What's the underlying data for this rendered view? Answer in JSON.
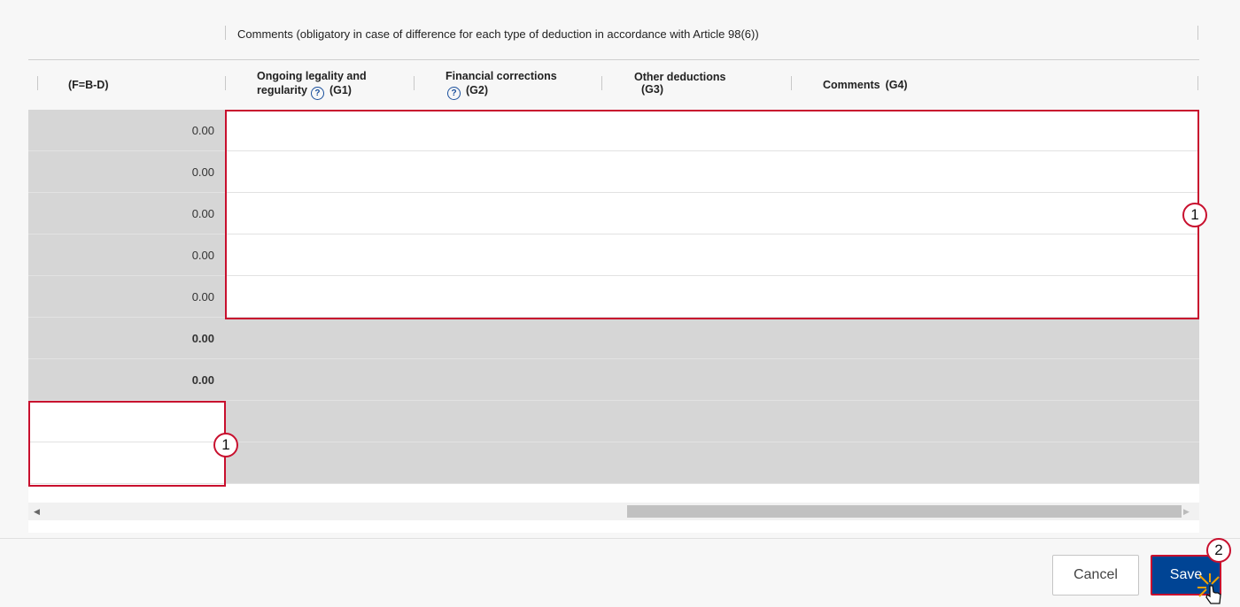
{
  "table": {
    "group_title": "Comments (obligatory in case of difference for each type of deduction in accordance with Article 98(6))",
    "columns": {
      "f": "(F=B-D)",
      "g1_line1": "Ongoing legality and",
      "g1_line2": "regularity",
      "g1_code": "(G1)",
      "g2_line1": "Financial corrections",
      "g2_code": "(G2)",
      "g3_line1": "Other deductions",
      "g3_code": "(G3)",
      "g4_label": "Comments",
      "g4_code": "(G4)"
    },
    "rows": [
      {
        "f": "0.00"
      },
      {
        "f": "0.00"
      },
      {
        "f": "0.00"
      },
      {
        "f": "0.00"
      },
      {
        "f": "0.00"
      },
      {
        "f": "0.00"
      },
      {
        "f": "0.00"
      },
      {
        "f": ""
      },
      {
        "f": ""
      }
    ]
  },
  "annotations": {
    "badge_1": "1",
    "badge_2": "2"
  },
  "icons": {
    "help": "question-circle-icon",
    "cursor": "hand-pointer-icon"
  },
  "footer": {
    "cancel_label": "Cancel",
    "save_label": "Save"
  },
  "colors": {
    "primary": "#004494",
    "highlight": "#c8102e",
    "readonly_cell": "#d6d6d6"
  }
}
